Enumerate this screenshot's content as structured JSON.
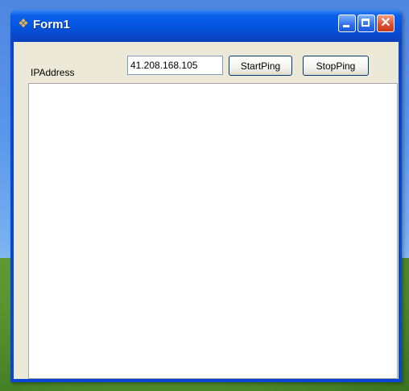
{
  "window": {
    "title": "Form1",
    "icon": "app-icon",
    "controls": {
      "minimize_icon": "minimize-icon",
      "maximize_icon": "maximize-icon",
      "close_icon": "close-icon",
      "close_glyph": "✕"
    }
  },
  "form": {
    "ip_label": "IPAddress",
    "ip_value": "41.208.168.105",
    "start_button": "StartPing",
    "stop_button": "StopPing",
    "output_text": ""
  },
  "colors": {
    "titlebar": "#0454dd",
    "client": "#ece9d8",
    "close_button": "#dd4d2d"
  }
}
